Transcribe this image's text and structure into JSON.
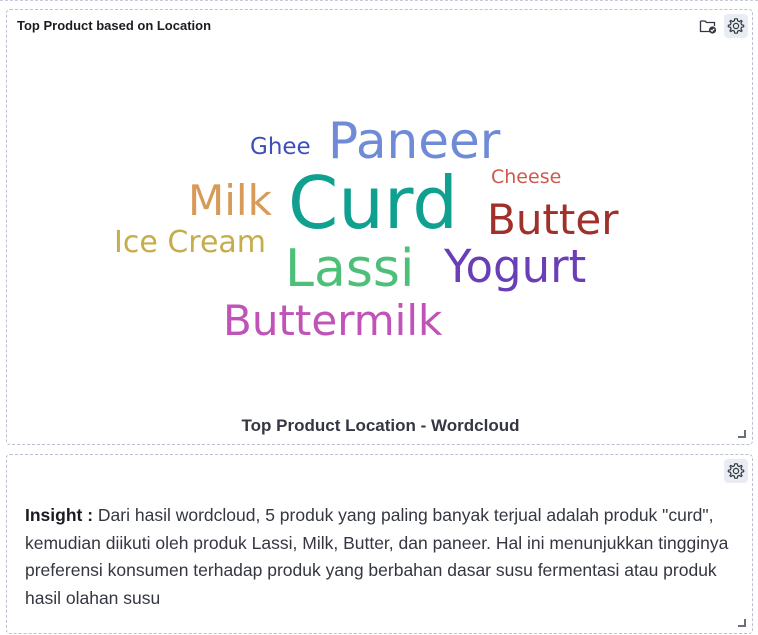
{
  "panels": {
    "wordcloud": {
      "title": "Top Product based on Location",
      "caption": "Top Product Location - Wordcloud",
      "words": [
        {
          "key": "curd",
          "text": "Curd",
          "color": "#10a090"
        },
        {
          "key": "paneer",
          "text": "Paneer",
          "color": "#6f8ad6"
        },
        {
          "key": "lassi",
          "text": "Lassi",
          "color": "#4cbf78"
        },
        {
          "key": "yogurt",
          "text": "Yogurt",
          "color": "#6a3fb6"
        },
        {
          "key": "butter",
          "text": "Butter",
          "color": "#a0302a"
        },
        {
          "key": "milk",
          "text": "Milk",
          "color": "#d79a58"
        },
        {
          "key": "buttermilk",
          "text": "Buttermilk",
          "color": "#c052b8"
        },
        {
          "key": "icecream",
          "text": "Ice Cream",
          "color": "#c6ad4c"
        },
        {
          "key": "ghee",
          "text": "Ghee",
          "color": "#3f4fb8"
        },
        {
          "key": "cheese",
          "text": "Cheese",
          "color": "#d0584a"
        }
      ],
      "icons": [
        "folder-check-icon",
        "gear-icon"
      ]
    },
    "insight": {
      "label": "Insight :",
      "text": "Dari hasil wordcloud, 5 produk yang paling banyak terjual adalah produk \"curd\", kemudian diikuti oleh produk Lassi, Milk, Butter, dan paneer. Hal ini menunjukkan tingginya preferensi konsumen terhadap produk yang berbahan dasar susu fermentasi atau produk hasil olahan susu",
      "icons": [
        "gear-icon"
      ]
    }
  }
}
